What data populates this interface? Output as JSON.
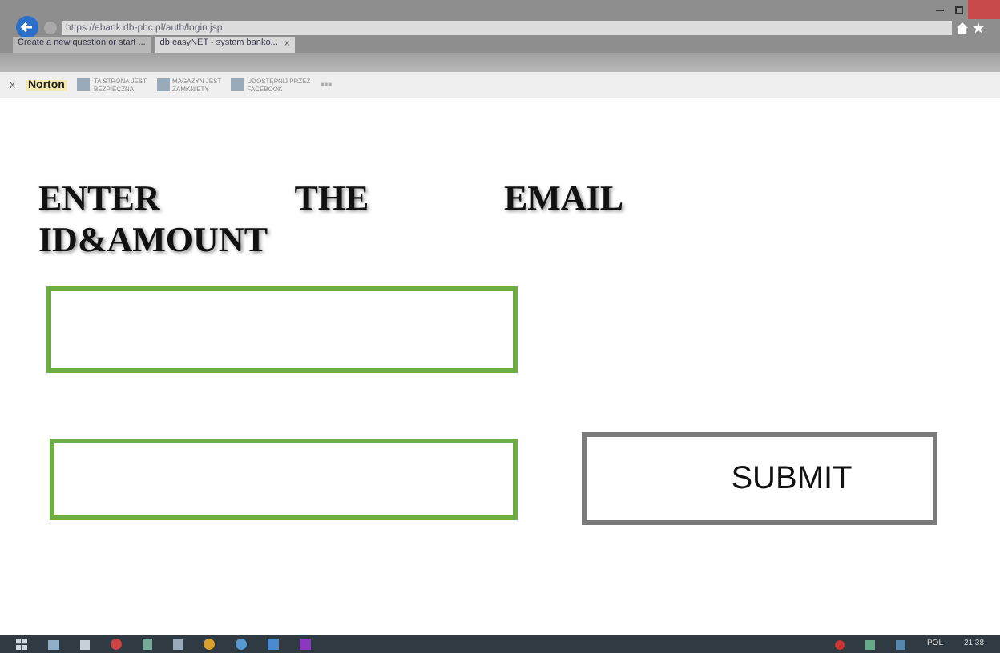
{
  "browser": {
    "address": "https://ebank.db-pbc.pl/auth/login.jsp",
    "tabs": [
      {
        "label": "Create a new question or start ...",
        "selected": false
      },
      {
        "label": "db easyNET - system banko...",
        "selected": true,
        "close": "×"
      }
    ],
    "toolbar": {
      "close": "x",
      "brand": "Norton",
      "items": [
        {
          "line1": "TA STRONA JEST",
          "line2": "BEZPIECZNA"
        },
        {
          "line1": "MAGAZYN JEST",
          "line2": "ZAMKNIĘTY"
        },
        {
          "line1": "UDOSTĘPNIJ PRZEZ",
          "line2": "FACEBOOK"
        }
      ],
      "more": "■■■"
    }
  },
  "page": {
    "heading": "ENTER THE EMAIL ID&AMOUNT",
    "submit": "SUBMIT"
  },
  "taskbar": {
    "language": "POL",
    "time": "21:38"
  }
}
